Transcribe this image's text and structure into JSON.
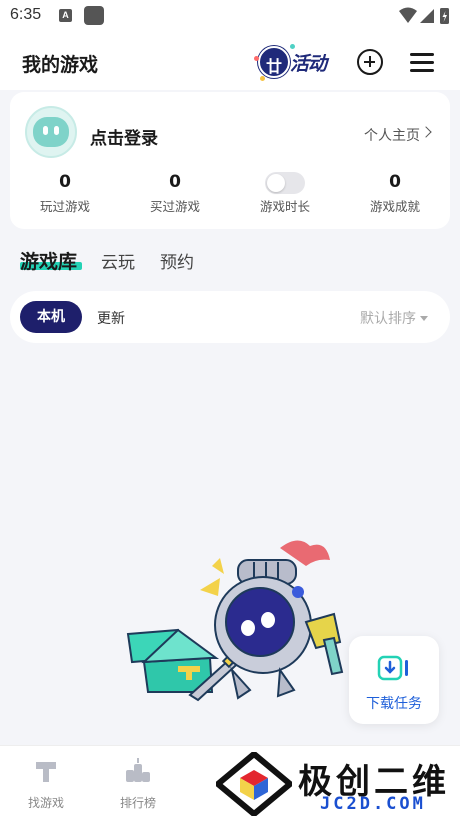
{
  "status_bar": {
    "time": "6:35",
    "a_badge": "A"
  },
  "header": {
    "title": "我的游戏",
    "event_badge_mark": "廿",
    "event_label": "活动"
  },
  "profile": {
    "login_text": "点击登录",
    "homepage_link": "个人主页",
    "stats": [
      {
        "value": "0",
        "label": "玩过游戏"
      },
      {
        "value": "0",
        "label": "买过游戏"
      },
      {
        "value": "",
        "label": "游戏时长"
      },
      {
        "value": "0",
        "label": "游戏成就"
      }
    ]
  },
  "tabs": [
    {
      "label": "游戏库",
      "active": true
    },
    {
      "label": "云玩",
      "active": false
    },
    {
      "label": "预约",
      "active": false
    }
  ],
  "filter": {
    "local_label": "本机",
    "update_label": "更新",
    "sort_label": "默认排序"
  },
  "download_fab": {
    "label": "下载任务"
  },
  "bottom_nav": [
    {
      "label": "找游戏",
      "icon": "hammer-icon"
    },
    {
      "label": "排行榜",
      "icon": "ranking-icon"
    }
  ],
  "watermark": {
    "title": "极创二维",
    "subtitle": "JC2D.COM"
  },
  "colors": {
    "accent_teal": "#23d2b5",
    "navy": "#1e1f6b",
    "link_blue": "#1e5fd9",
    "brand_red": "#e3262e"
  }
}
